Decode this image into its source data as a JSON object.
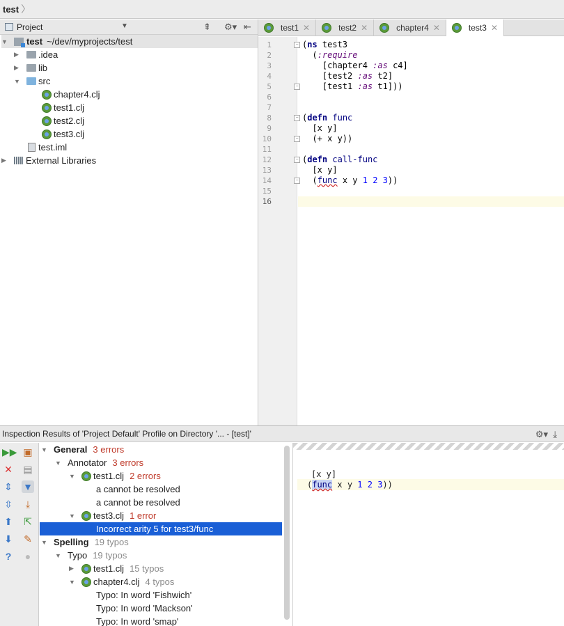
{
  "breadcrumb": {
    "project": "test"
  },
  "project_panel": {
    "title": "Project",
    "tree": [
      {
        "label": "test",
        "extra": "~/dev/myprojects/test",
        "type": "module",
        "expanded": true
      },
      {
        "label": ".idea",
        "type": "folder"
      },
      {
        "label": "lib",
        "type": "folder"
      },
      {
        "label": "src",
        "type": "folder-blue",
        "expanded": true
      },
      {
        "label": "chapter4.clj",
        "type": "clj"
      },
      {
        "label": "test1.clj",
        "type": "clj"
      },
      {
        "label": "test2.clj",
        "type": "clj"
      },
      {
        "label": "test3.clj",
        "type": "clj"
      },
      {
        "label": "test.iml",
        "type": "iml"
      },
      {
        "label": "External Libraries",
        "type": "libs"
      }
    ]
  },
  "editor": {
    "tabs": [
      {
        "label": "test1",
        "active": false
      },
      {
        "label": "test2",
        "active": false
      },
      {
        "label": "chapter4",
        "active": false
      },
      {
        "label": "test3",
        "active": true
      }
    ],
    "line_numbers": [
      "1",
      "2",
      "3",
      "4",
      "5",
      "6",
      "7",
      "8",
      "9",
      "10",
      "11",
      "12",
      "13",
      "14",
      "15",
      "16"
    ]
  },
  "inspection": {
    "title": "Inspection Results of 'Project Default' Profile on Directory '... - [test]'",
    "general": {
      "label": "General",
      "count": "3 errors"
    },
    "annotator": {
      "label": "Annotator",
      "count": "3 errors"
    },
    "test1": {
      "label": "test1.clj",
      "count": "2 errors"
    },
    "resolve1": "a cannot be resolved",
    "resolve2": "a cannot be resolved",
    "test3": {
      "label": "test3.clj",
      "count": "1 error"
    },
    "selected": "Incorrect arity 5 for test3/func",
    "spelling": {
      "label": "Spelling",
      "count": "19 typos"
    },
    "typo": {
      "label": "Typo",
      "count": "19 typos"
    },
    "test1_typos": {
      "label": "test1.clj",
      "count": "15 typos"
    },
    "chapter4_typos": {
      "label": "chapter4.clj",
      "count": "4 typos"
    },
    "typos": [
      "Typo: In word 'Fishwich'",
      "Typo: In word 'Mackson'",
      "Typo: In word 'smap'"
    ]
  }
}
